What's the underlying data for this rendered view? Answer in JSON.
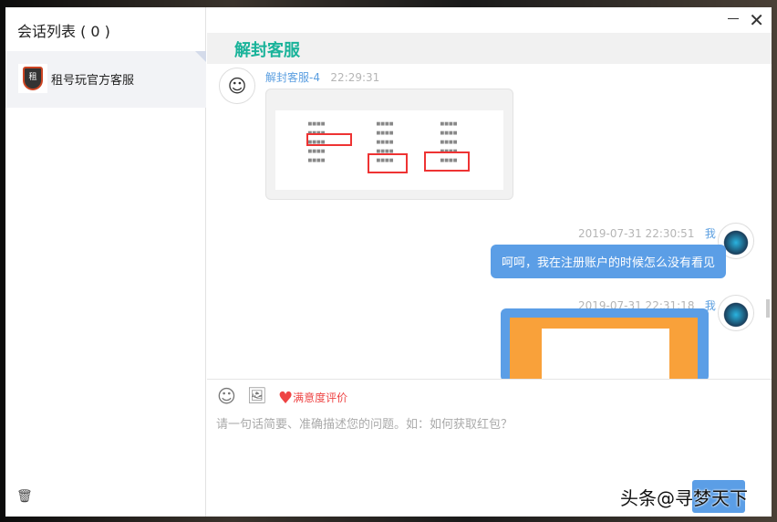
{
  "sidebar": {
    "title": "会话列表 ( 0 )",
    "conversations": [
      {
        "name": "租号玩官方客服",
        "logo_text": "租"
      }
    ]
  },
  "chat": {
    "title": "解封客服",
    "messages": [
      {
        "sender": "解封客服-4",
        "time": "22:29:31",
        "type": "image"
      },
      {
        "sender": "我",
        "time": "2019-07-31 22:30:51",
        "type": "text",
        "text": "呵呵，我在注册账户的时候怎么没有看见"
      },
      {
        "sender": "我",
        "time": "2019-07-31 22:31:18",
        "type": "image"
      }
    ]
  },
  "toolbar": {
    "satisfaction_label": "满意度评价"
  },
  "input": {
    "placeholder": "请一句话简要、准确描述您的问题。如：如何获取红包？"
  },
  "watermark": "头条@寻梦天下",
  "colors": {
    "accent": "#5b9ee6",
    "title": "#1ab39a",
    "heart": "#e44444"
  }
}
